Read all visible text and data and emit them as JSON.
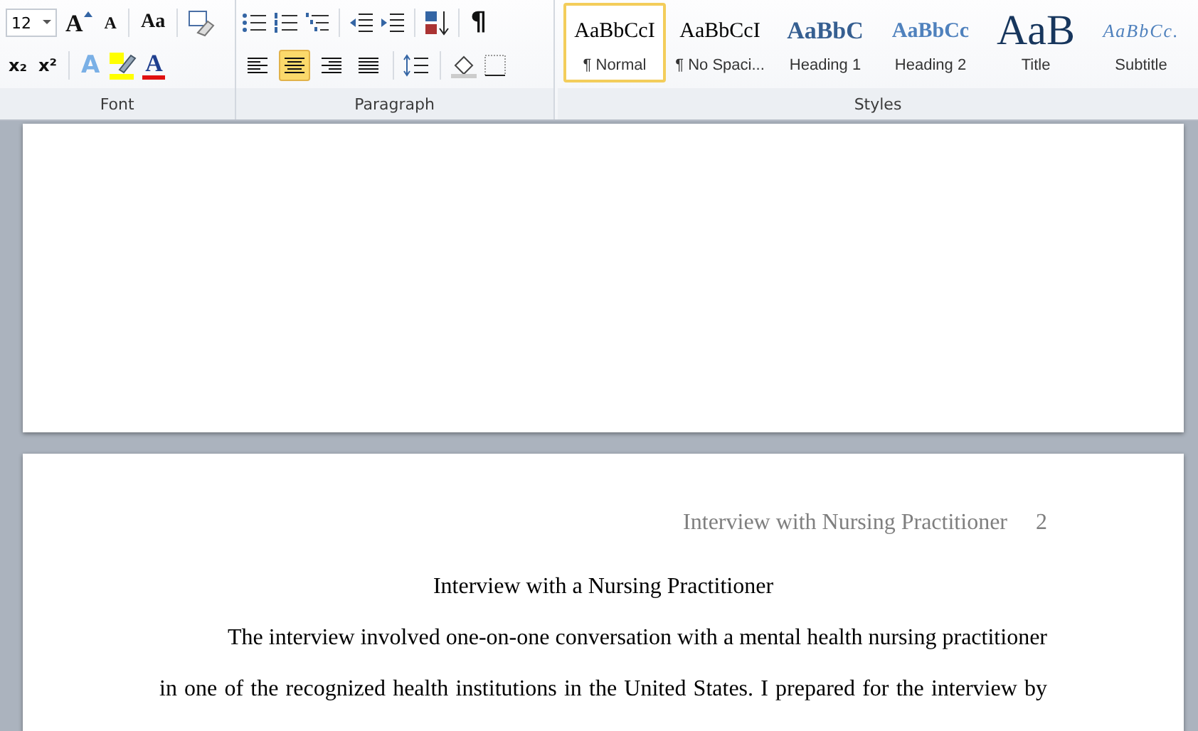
{
  "ribbon": {
    "font": {
      "size": "12",
      "grow": "A",
      "shrink": "A",
      "change_case": "Aa",
      "subscript": "x₂",
      "superscript": "x²",
      "text_effects": "A",
      "font_color": "A",
      "label": "Font"
    },
    "paragraph": {
      "show_marks": "¶",
      "alignments": [
        {
          "selected": false
        },
        {
          "selected": true
        },
        {
          "selected": false
        },
        {
          "selected": false
        }
      ],
      "label": "Paragraph"
    },
    "styles": {
      "items": [
        {
          "preview": "AaBbCcI",
          "name": "¶ Normal",
          "selected": true,
          "kind": "normal"
        },
        {
          "preview": "AaBbCcI",
          "name": "¶ No Spaci...",
          "selected": false,
          "kind": "normal"
        },
        {
          "preview": "AaBbC",
          "name": "Heading 1",
          "selected": false,
          "kind": "heading1"
        },
        {
          "preview": "AaBbCc",
          "name": "Heading 2",
          "selected": false,
          "kind": "heading2"
        },
        {
          "preview": "AaB",
          "name": "Title",
          "selected": false,
          "kind": "title"
        },
        {
          "preview": "AaBbCc.",
          "name": "Subtitle",
          "selected": false,
          "kind": "subtitle"
        }
      ],
      "label": "Styles"
    }
  },
  "document": {
    "header": {
      "title": "Interview with Nursing Practitioner",
      "page_number": "2"
    },
    "title": "Interview with a Nursing Practitioner",
    "lines": [
      "The interview involved one-on-one conversation with a mental health nursing practitioner",
      "in one of the recognized health institutions in the United States. I prepared for the interview by"
    ]
  }
}
